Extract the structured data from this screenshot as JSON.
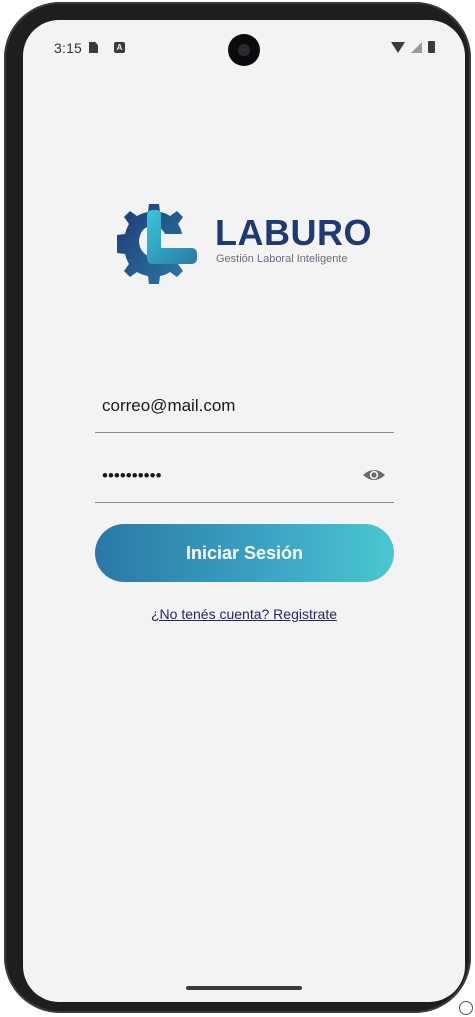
{
  "status_bar": {
    "time": "3:15",
    "sim_icon": "sim-card-icon",
    "notif_icon": "a-badge-icon",
    "notif_letter": "A",
    "wifi_icon": "wifi-icon",
    "signal_icon": "signal-icon",
    "battery_icon": "battery-icon"
  },
  "logo": {
    "name": "LABURO",
    "tagline": "Gestión Laboral Inteligente",
    "icon": "gear-l-logo-icon"
  },
  "form": {
    "email_value": "correo@mail.com",
    "password_masked": "••••••••••",
    "password_toggle_icon": "eye-icon",
    "login_label": "Iniciar Sesión",
    "register_link": "¿No tenés cuenta? Registrate"
  },
  "colors": {
    "brand_dark": "#1f3a72",
    "gradient_start": "#2b78a6",
    "gradient_end": "#4bc7d0",
    "link": "#1f2a6e",
    "screen_bg": "#f3f3f3"
  }
}
